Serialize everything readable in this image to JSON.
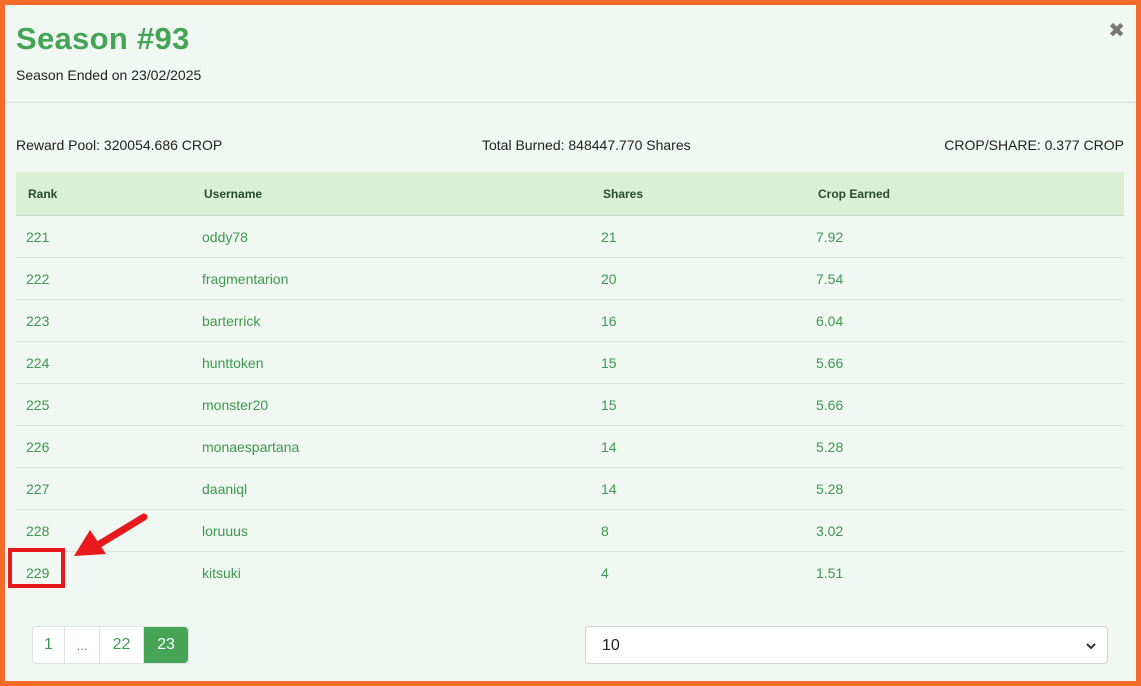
{
  "header": {
    "title": "Season #93",
    "subtitle": "Season Ended on 23/02/2025",
    "close_label": "✖"
  },
  "stats": {
    "reward_pool": "Reward Pool: 320054.686 CROP",
    "total_burned": "Total Burned: 848447.770 Shares",
    "crop_per_share": "CROP/SHARE: 0.377 CROP"
  },
  "table": {
    "columns": [
      "Rank",
      "Username",
      "Shares",
      "Crop Earned"
    ],
    "rows": [
      {
        "rank": "221",
        "username": "oddy78",
        "shares": "21",
        "crop": "7.92"
      },
      {
        "rank": "222",
        "username": "fragmentarion",
        "shares": "20",
        "crop": "7.54"
      },
      {
        "rank": "223",
        "username": "barterrick",
        "shares": "16",
        "crop": "6.04"
      },
      {
        "rank": "224",
        "username": "hunttoken",
        "shares": "15",
        "crop": "5.66"
      },
      {
        "rank": "225",
        "username": "monster20",
        "shares": "15",
        "crop": "5.66"
      },
      {
        "rank": "226",
        "username": "monaespartana",
        "shares": "14",
        "crop": "5.28"
      },
      {
        "rank": "227",
        "username": "daaniql",
        "shares": "14",
        "crop": "5.28"
      },
      {
        "rank": "228",
        "username": "loruuus",
        "shares": "8",
        "crop": "3.02"
      },
      {
        "rank": "229",
        "username": "kitsuki",
        "shares": "4",
        "crop": "1.51"
      }
    ]
  },
  "pagination": {
    "pages": [
      "1",
      "...",
      "22",
      "23"
    ],
    "active": "23"
  },
  "page_size": {
    "value": "10"
  },
  "colors": {
    "accent": "#45a455",
    "header_bg": "#d8f1d4",
    "annotation": "#e8191c",
    "frame": "#f36a2a"
  }
}
